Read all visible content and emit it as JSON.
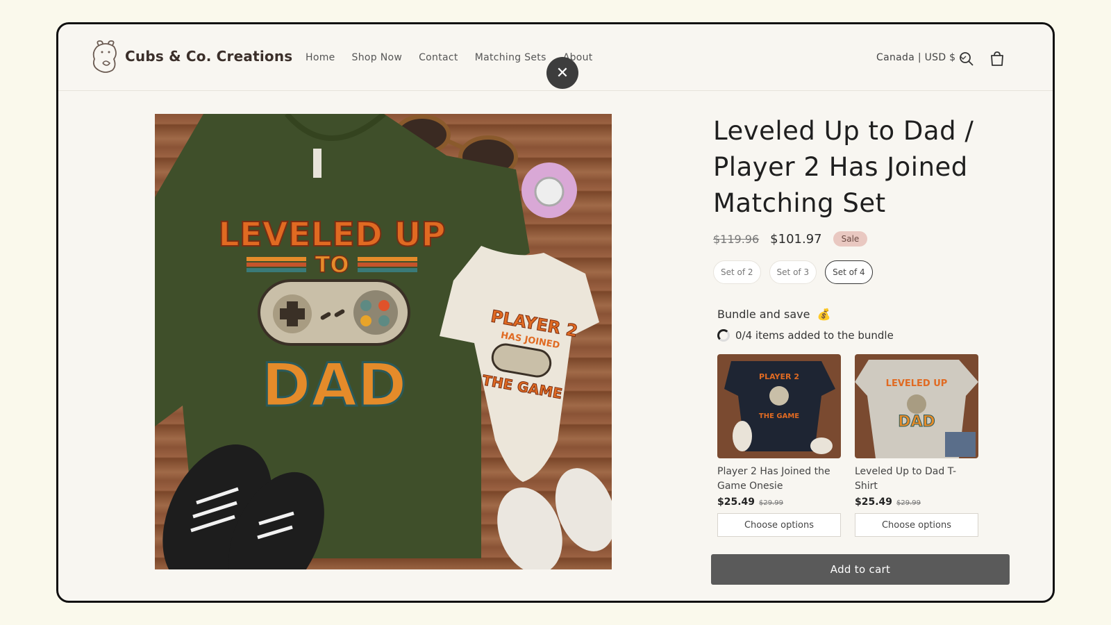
{
  "header": {
    "brand": "Cubs & Co. Creations",
    "nav": [
      "Home",
      "Shop Now",
      "Contact",
      "Matching Sets",
      "About"
    ],
    "currency": "Canada | USD $",
    "close_symbol": "✕"
  },
  "product": {
    "title": "Leveled Up to Dad / Player 2 Has Joined Matching Set",
    "compare_price": "$119.96",
    "price": "$101.97",
    "badge": "Sale",
    "variants": [
      {
        "label": "Set of 2",
        "selected": false
      },
      {
        "label": "Set of 3",
        "selected": false
      },
      {
        "label": "Set of 4",
        "selected": true
      }
    ],
    "shirt_text": {
      "line1": "LEVELED UP",
      "line2": "TO",
      "line3": "DAD"
    },
    "onesie_text": {
      "line1": "PLAYER 2",
      "line2": "HAS JOINED",
      "line3": "THE GAME"
    }
  },
  "bundle": {
    "title": "Bundle and save",
    "emoji": "💰",
    "progress": "0/4 items added to the bundle",
    "items": [
      {
        "name": "Player 2 Has Joined the Game Onesie",
        "price": "$25.49",
        "compare": "$29.99",
        "button": "Choose options"
      },
      {
        "name": "Leveled Up to Dad T-Shirt",
        "price": "$25.49",
        "compare": "$29.99",
        "button": "Choose options"
      }
    ]
  },
  "cta": {
    "add_to_cart": "Add to cart"
  },
  "colors": {
    "page_bg": "#faf9ec",
    "window_bg": "#f8f6f1",
    "shirt_green": "#3f4f2a",
    "wood": "#8a5336",
    "sale_badge": "#e9c8c1",
    "add_to_cart_bg": "#5a5a5a"
  }
}
